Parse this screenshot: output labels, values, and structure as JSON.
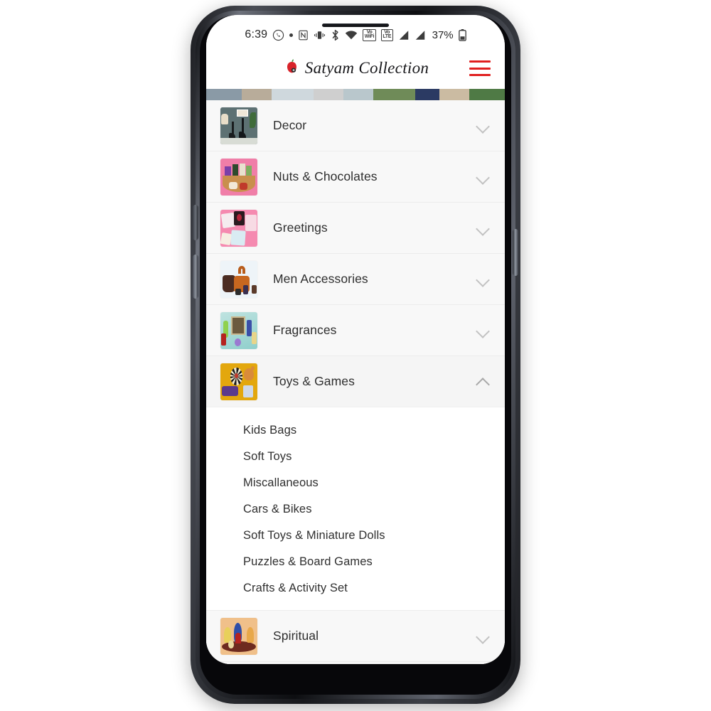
{
  "statusbar": {
    "time": "6:39",
    "icons": [
      "whatsapp-icon",
      "dot-indicator",
      "nfc-icon",
      "vibrate-icon",
      "bluetooth-icon",
      "wifi-icon",
      "volte-wifi-2-icon",
      "volte-1-icon",
      "signal-bars-1",
      "signal-bars-2"
    ],
    "nfc_label": "N",
    "vowifi_label_top": "Vo",
    "vowifi_label_bottom": "WiFi",
    "vowifi_index": "2",
    "volte_label_top": "Vo",
    "volte_label_bottom": "LTE",
    "volte_index": "1",
    "battery_percent": "37%"
  },
  "header": {
    "brand_name": "Satyam Collection",
    "logo_icon": "apple-logo-icon",
    "menu_icon": "hamburger-menu-icon",
    "menu_color": "#e02020"
  },
  "categories": [
    {
      "label": "Decor",
      "thumb": "t-decor",
      "expanded": false,
      "chevron": "chevron-down-icon"
    },
    {
      "label": "Nuts & Chocolates",
      "thumb": "t-nuts",
      "expanded": false,
      "chevron": "chevron-down-icon"
    },
    {
      "label": "Greetings",
      "thumb": "t-greet",
      "expanded": false,
      "chevron": "chevron-down-icon"
    },
    {
      "label": "Men Accessories",
      "thumb": "t-men",
      "expanded": false,
      "chevron": "chevron-down-icon"
    },
    {
      "label": "Fragrances",
      "thumb": "t-frag",
      "expanded": false,
      "chevron": "chevron-down-icon"
    },
    {
      "label": "Toys & Games",
      "thumb": "t-toys",
      "expanded": true,
      "chevron": "chevron-up-icon"
    },
    {
      "label": "Spiritual",
      "thumb": "t-spirit",
      "expanded": false,
      "chevron": "chevron-down-icon"
    }
  ],
  "submenu": {
    "parent": "Toys & Games",
    "items": [
      "Kids Bags",
      "Soft Toys",
      "Miscallaneous",
      "Cars & Bikes",
      "Soft Toys & Miniature Dolls",
      "Puzzles & Board Games",
      "Crafts & Activity Set"
    ]
  },
  "colors": {
    "page_background": "#f7f7f7",
    "row_background": "#f8f8f8",
    "submenu_background": "#ffffff",
    "divider": "#ececec",
    "text": "#2e2e2e",
    "chevron": "#c2c2c2",
    "accent_red": "#e02020"
  }
}
